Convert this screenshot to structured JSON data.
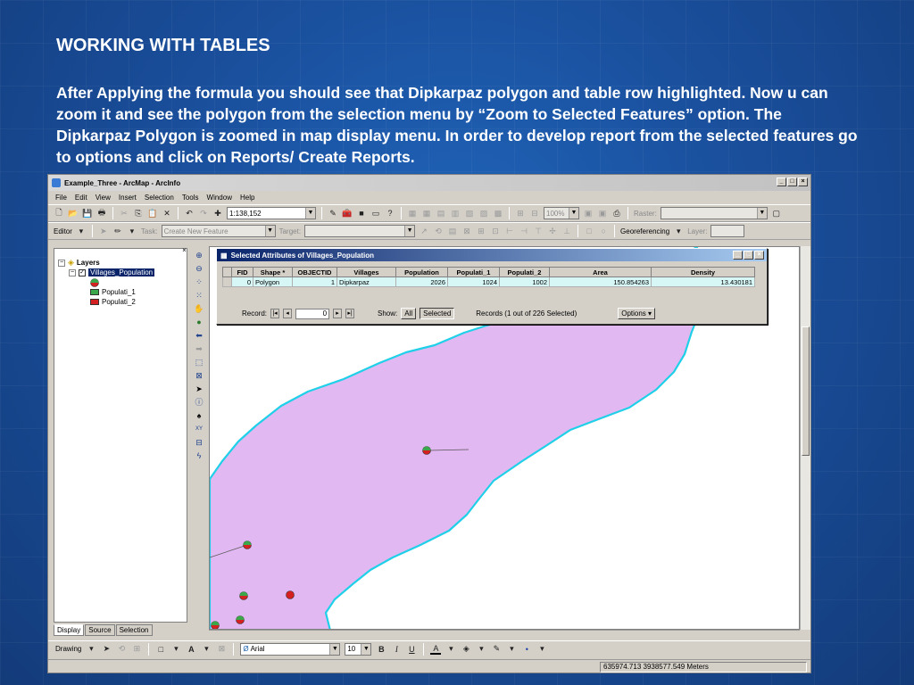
{
  "slide": {
    "title": "WORKING WITH TABLES",
    "body": "After Applying the formula you should see that Dipkarpaz polygon and table row highlighted. Now u can zoom it and see the polygon from the selection menu by “Zoom to Selected Features” option. The Dipkarpaz Polygon is zoomed in map display menu. In order to develop report from the selected features go to options and click on Reports/ Create Reports."
  },
  "window": {
    "title": "Example_Three - ArcMap - ArcInfo",
    "menus": [
      "File",
      "Edit",
      "View",
      "Insert",
      "Selection",
      "Tools",
      "Window",
      "Help"
    ],
    "scale": "1:138,152",
    "zoom_percent": "100%",
    "raster_label": "Raster:",
    "editor_label": "Editor",
    "task_label": "Task:",
    "task_value": "Create New Feature",
    "target_label": "Target:",
    "georef_label": "Georeferencing",
    "layer_label": "Layer:"
  },
  "toc": {
    "root": "Layers",
    "layer": "Villages_Population",
    "legend": [
      {
        "label": "Populati_1",
        "color": "#3aa84a"
      },
      {
        "label": "Populati_2",
        "color": "#d42020"
      }
    ],
    "tabs": [
      "Display",
      "Source",
      "Selection"
    ]
  },
  "attr_table": {
    "title": "Selected Attributes of Villages_Population",
    "headers": [
      "FID",
      "Shape *",
      "OBJECTID",
      "Villages",
      "Population",
      "Populati_1",
      "Populati_2",
      "Area",
      "Density"
    ],
    "row": [
      "0",
      "Polygon",
      "1",
      "Dipkarpaz",
      "2026",
      "1024",
      "1002",
      "150.854263",
      "13.430181"
    ],
    "record_label": "Record:",
    "record_value": "0",
    "show_label": "Show:",
    "show_all": "All",
    "show_selected": "Selected",
    "records_text": "Records (1 out of 226 Selected)",
    "options_label": "Options"
  },
  "drawbar": {
    "drawing_label": "Drawing",
    "font": "Arial",
    "size": "10"
  },
  "status": {
    "coords": "635974.713  3938577.549 Meters"
  },
  "colors": {
    "polygon_fill": "#e2b8f2",
    "polygon_outline": "#1fd0e8",
    "selected_row": "#d7f7f7"
  }
}
